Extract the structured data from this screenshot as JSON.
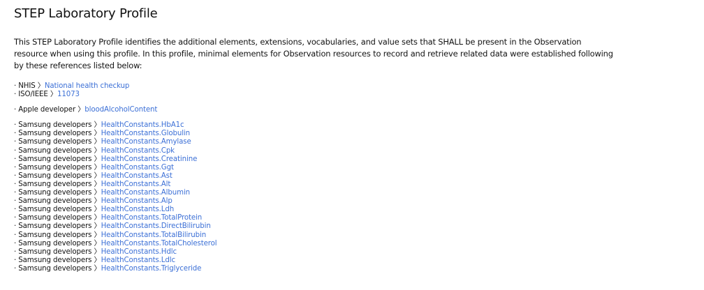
{
  "page": {
    "title": "STEP Laboratory Profile",
    "intro": "This STEP Laboratory Profile identifies the additional elements, extensions, vocabularies, and value sets that SHALL be present in the Observation resource when using this profile. In this profile, minimal elements for Observation resources to record and retrieve related data were established following by these references listed below:"
  },
  "bullet": "·",
  "separator": "〉",
  "references": [
    {
      "items": [
        {
          "source": "NHIS",
          "link": "National health checkup"
        },
        {
          "source": "ISO/IEEE",
          "link": "11073"
        }
      ]
    },
    {
      "items": [
        {
          "source": "Apple developer",
          "link": "bloodAlcoholContent"
        }
      ]
    },
    {
      "items": [
        {
          "source": "Samsung developers",
          "link": "HealthConstants.HbA1c"
        },
        {
          "source": "Samsung developers",
          "link": "HealthConstants.Globulin"
        },
        {
          "source": "Samsung developers",
          "link": "HealthConstants.Amylase"
        },
        {
          "source": "Samsung developers",
          "link": "HealthConstants.Cpk"
        },
        {
          "source": "Samsung developers",
          "link": "HealthConstants.Creatinine"
        },
        {
          "source": "Samsung developers",
          "link": "HealthConstants.Ggt"
        },
        {
          "source": "Samsung developers",
          "link": "HealthConstants.Ast"
        },
        {
          "source": "Samsung developers",
          "link": "HealthConstants.Alt"
        },
        {
          "source": "Samsung developers",
          "link": "HealthConstants.Albumin"
        },
        {
          "source": "Samsung developers",
          "link": "HealthConstants.Alp"
        },
        {
          "source": "Samsung developers",
          "link": "HealthConstants.Ldh"
        },
        {
          "source": "Samsung developers",
          "link": "HealthConstants.TotalProtein"
        },
        {
          "source": "Samsung developers",
          "link": "HealthConstants.DirectBilirubin"
        },
        {
          "source": "Samsung developers",
          "link": "HealthConstants.TotalBilirubin"
        },
        {
          "source": "Samsung developers",
          "link": "HealthConstants.TotalCholesterol"
        },
        {
          "source": "Samsung developers",
          "link": "HealthConstants.Hdlc"
        },
        {
          "source": "Samsung developers",
          "link": "HealthConstants.Ldlc"
        },
        {
          "source": "Samsung developers",
          "link": "HealthConstants.Triglyceride"
        }
      ]
    }
  ],
  "colors": {
    "text": "#111111",
    "link": "#3b6fd6",
    "background": "#ffffff"
  }
}
